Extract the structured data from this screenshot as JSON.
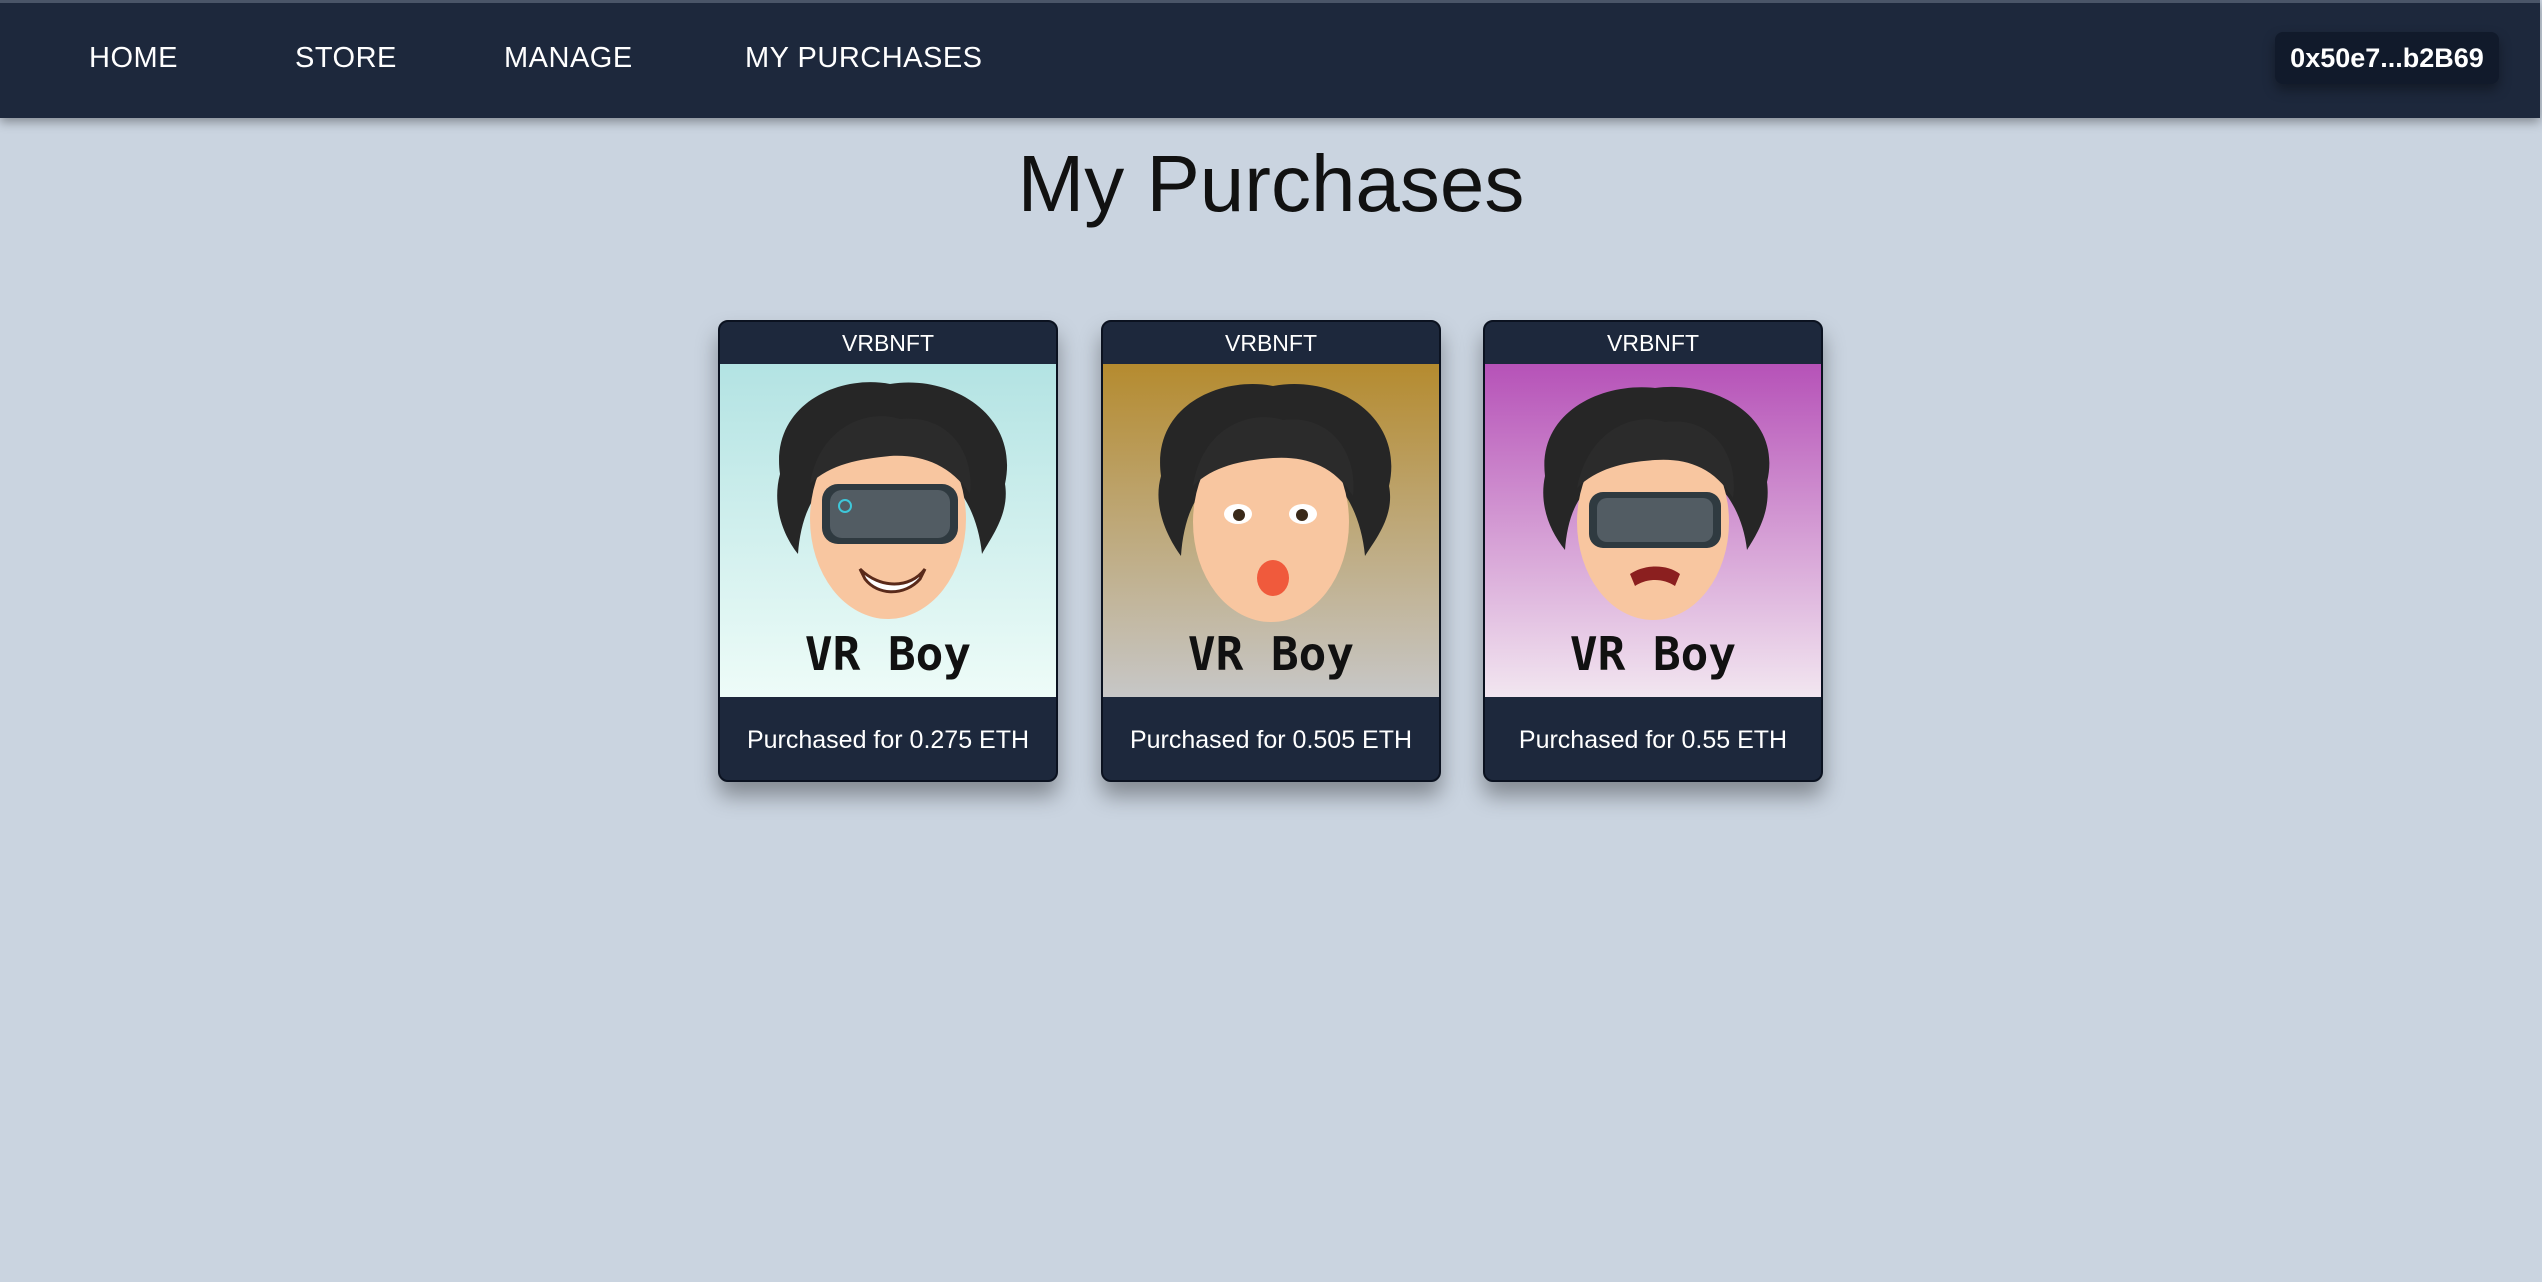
{
  "nav": {
    "items": [
      {
        "label": "HOME"
      },
      {
        "label": "STORE"
      },
      {
        "label": "MANAGE"
      },
      {
        "label": "MY PURCHASES"
      }
    ],
    "wallet_label": "0x50e7...b2B69"
  },
  "page": {
    "title": "My Purchases"
  },
  "cards": [
    {
      "collection": "VRBNFT",
      "image_text": "VR Boy",
      "price_label": "Purchased for 0.275 ETH",
      "bg_top": "#b3e3e3",
      "bg_bottom": "#eefcf8",
      "expression": "grin"
    },
    {
      "collection": "VRBNFT",
      "image_text": "VR Boy",
      "price_label": "Purchased for 0.505 ETH",
      "bg_top": "#b58b2f",
      "bg_bottom": "#c7c7c7",
      "expression": "tongue"
    },
    {
      "collection": "VRBNFT",
      "image_text": "VR Boy",
      "price_label": "Purchased for 0.55 ETH",
      "bg_top": "#b652b8",
      "bg_bottom": "#f2e6f0",
      "expression": "angry"
    }
  ]
}
